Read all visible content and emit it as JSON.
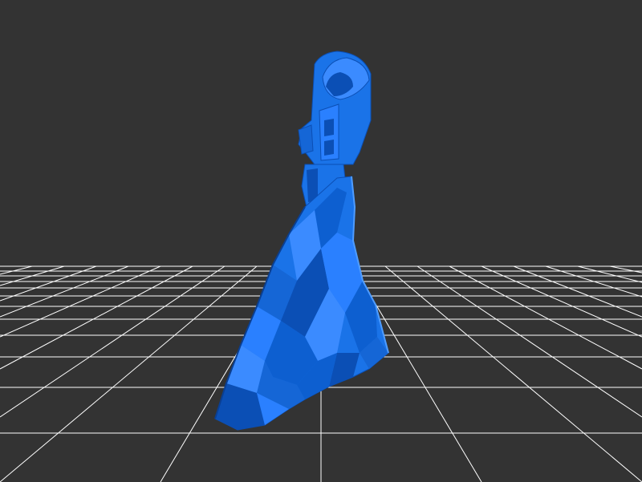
{
  "viewport": {
    "background_color": "#333333",
    "grid_color": "#ffffff",
    "model_color": "#1a73e8",
    "model_highlight_color": "#3b8bff",
    "model_shadow_color": "#0b4fb5"
  },
  "model": {
    "icon": "3d-mesh-figure"
  }
}
